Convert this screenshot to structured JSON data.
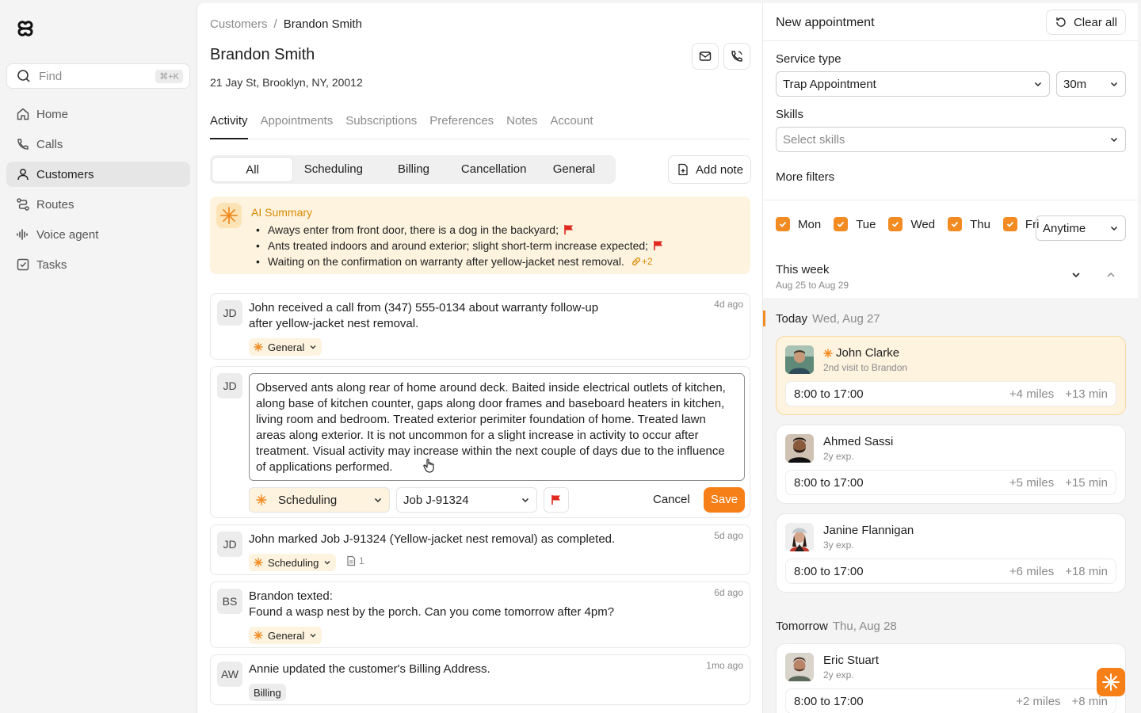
{
  "sidebar": {
    "find_placeholder": "Find",
    "find_shortcut": "⌘+K",
    "items": [
      {
        "label": "Home",
        "icon": "home-icon"
      },
      {
        "label": "Calls",
        "icon": "phone-icon"
      },
      {
        "label": "Customers",
        "icon": "user-icon",
        "active": true
      },
      {
        "label": "Routes",
        "icon": "route-icon"
      },
      {
        "label": "Voice agent",
        "icon": "voice-icon"
      },
      {
        "label": "Tasks",
        "icon": "tasks-icon"
      }
    ]
  },
  "main": {
    "breadcrumb": {
      "parent": "Customers",
      "separator": "/",
      "current": "Brandon Smith"
    },
    "title": "Brandon Smith",
    "address": "21 Jay St, Brooklyn, NY, 20012",
    "tabs": [
      "Activity",
      "Appointments",
      "Subscriptions",
      "Preferences",
      "Notes",
      "Account"
    ],
    "filters": [
      "All",
      "Scheduling",
      "Billing",
      "Cancellation",
      "General"
    ],
    "add_note_label": "Add note",
    "ai_summary": {
      "title": "AI Summary",
      "items": [
        "Aways enter from front door, there is a dog in the backyard;",
        "Ants treated indoors and around exterior; slight short-term increase expected;",
        "Waiting on the confirmation on warranty after yellow-jacket nest removal."
      ],
      "link_count": "+2"
    },
    "activity": [
      {
        "initials": "JD",
        "line1": "John received a call from (347) 555-0134 about warranty follow-up",
        "line2": "after yellow-jacket nest removal.",
        "time": "4d ago",
        "tag": "General"
      },
      {
        "initials": "JD",
        "editor_text": "Observed ants along rear of home around deck. Baited inside electrical outlets of kitchen, along base of kitchen counter, gaps along door frames and baseboard heaters in kitchen, living room and bedroom. Treated exterior perimiter foundation of home. Treated lawn areas along exterior. It is not uncommon for a slight increase in activity to occur after treatment. Visual activity may increase within the next couple of days due to the influence of applications performed.",
        "category": "Scheduling",
        "job": "Job J-91324",
        "cancel": "Cancel",
        "save": "Save"
      },
      {
        "initials": "JD",
        "line1": "John marked Job J-91324 (Yellow-jacket nest removal) as completed.",
        "time": "5d ago",
        "tag": "Scheduling",
        "attachments": "1"
      },
      {
        "initials": "BS",
        "line1": "Brandon texted:",
        "line2": "Found a wasp nest by the porch. Can you come tomorrow after 4pm?",
        "time": "6d ago",
        "tag": "General"
      },
      {
        "initials": "AW",
        "line1": "Annie updated the customer's Billing Address.",
        "time": "1mo ago",
        "tag": "Billing"
      }
    ]
  },
  "panel": {
    "title": "New appointment",
    "clear_all": "Clear all",
    "service_type_label": "Service type",
    "service_type_value": "Trap Appointment",
    "duration_value": "30m",
    "skills_label": "Skills",
    "skills_placeholder": "Select skills",
    "more_filters": "More filters",
    "days": [
      "Mon",
      "Tue",
      "Wed",
      "Thu",
      "Fri"
    ],
    "time_window": "Anytime",
    "week_title": "This week",
    "week_range": "Aug 25 to Aug 29",
    "today": {
      "label": "Today",
      "date": "Wed, Aug 27"
    },
    "tomorrow": {
      "label": "Tomorrow",
      "date": "Thu, Aug 28"
    },
    "techs_today": [
      {
        "name": "John Clarke",
        "sub": "2nd visit to Brandon",
        "slot": "8:00 to 17:00",
        "miles": "+4 miles",
        "mins": "+13 min"
      },
      {
        "name": "Ahmed Sassi",
        "sub": "2y exp.",
        "slot": "8:00 to 17:00",
        "miles": "+5 miles",
        "mins": "+15 min"
      },
      {
        "name": "Janine Flannigan",
        "sub": "3y exp.",
        "slot": "8:00 to 17:00",
        "miles": "+6 miles",
        "mins": "+18 min"
      }
    ],
    "techs_tomorrow": [
      {
        "name": "Eric Stuart",
        "sub": "2y exp.",
        "slot": "8:00 to 17:00",
        "miles": "+2 miles",
        "mins": "+8 min"
      }
    ]
  },
  "colors": {
    "accent": "#f77f17",
    "ai_bg": "#fdf3df",
    "ai_text": "#d68a00",
    "flag": "#e0281e"
  }
}
